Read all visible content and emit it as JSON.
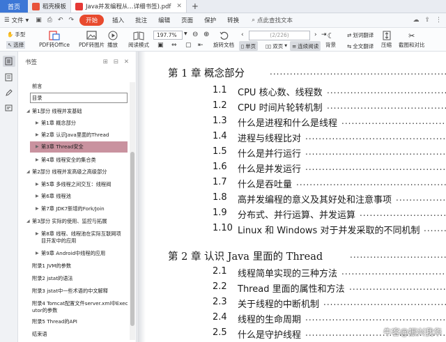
{
  "tabs": [
    {
      "label": "首页"
    },
    {
      "label": "稻壳模板"
    },
    {
      "label": "Java并发编程从...详细书签).pdf"
    }
  ],
  "menu": {
    "file": "文件",
    "items": [
      "开始",
      "插入",
      "批注",
      "编辑",
      "页面",
      "保护",
      "转换"
    ],
    "search": "点此查找文本"
  },
  "toolbar": {
    "hand": "手型",
    "select": "选择",
    "pdf_to_office": "PDF转Office",
    "pdf_to_image": "PDF转图片",
    "play": "播放",
    "read_mode": "阅读模式",
    "zoom": "197.7%",
    "page_input": "(2/226)",
    "rotate": "旋转文档",
    "single": "单页",
    "double": "双页",
    "continuous": "连续阅读",
    "background": "背景",
    "translate_word": "划词翻译",
    "translate_full": "全文翻译",
    "compress": "压缩",
    "screenshot": "截图和对比"
  },
  "bookmarks": {
    "title": "书签",
    "items": [
      {
        "label": "前言",
        "indent": 0,
        "arrow": false,
        "selected": false,
        "boxed": false
      },
      {
        "label": "目录",
        "indent": 0,
        "arrow": false,
        "selected": false,
        "boxed": true
      },
      {
        "label": "第1部分 线程并发基础",
        "indent": 0,
        "arrow": true,
        "selected": false,
        "boxed": false
      },
      {
        "label": "第1章 概念部分",
        "indent": 1,
        "arrow": true,
        "selected": false,
        "boxed": false
      },
      {
        "label": "第2章 认识Java里面的Thread",
        "indent": 1,
        "arrow": true,
        "selected": false,
        "boxed": false
      },
      {
        "label": "第3章 Thread安全",
        "indent": 1,
        "arrow": true,
        "selected": true,
        "boxed": false
      },
      {
        "label": "第4章 线程安全的集合类",
        "indent": 1,
        "arrow": true,
        "selected": false,
        "boxed": false
      },
      {
        "label": "第2部分 线程并发高级之高级部分",
        "indent": 0,
        "arrow": true,
        "selected": false,
        "boxed": false
      },
      {
        "label": "第5章 多线程之间交互：线程阀",
        "indent": 1,
        "arrow": true,
        "selected": false,
        "boxed": false
      },
      {
        "label": "第6章 线程池",
        "indent": 1,
        "arrow": true,
        "selected": false,
        "boxed": false
      },
      {
        "label": "第7章 JDK7新增的Fork/Join",
        "indent": 1,
        "arrow": true,
        "selected": false,
        "boxed": false
      },
      {
        "label": "第3部分 实际的使用、监控与拓展",
        "indent": 0,
        "arrow": true,
        "selected": false,
        "boxed": false
      },
      {
        "label": "第8章 线程、线程池在实际互联网项",
        "label2": "目开发中的应用",
        "indent": 1,
        "arrow": true,
        "selected": false,
        "boxed": false
      },
      {
        "label": "第9章 Android中线程的应用",
        "indent": 1,
        "arrow": true,
        "selected": false,
        "boxed": false
      },
      {
        "label": "附录1 JVM的参数",
        "indent": 0,
        "arrow": false,
        "selected": false,
        "boxed": false
      },
      {
        "label": "附录2 jstat的语法",
        "indent": 0,
        "arrow": false,
        "selected": false,
        "boxed": false
      },
      {
        "label": "附录3 jstat中一些术语的中文解释",
        "indent": 0,
        "arrow": false,
        "selected": false,
        "boxed": false
      },
      {
        "label": "附录4 Tomcat配置文件server.xml中Exec",
        "label2": "utor的参数",
        "indent": 0,
        "arrow": false,
        "selected": false,
        "boxed": false
      },
      {
        "label": "附录5 Thread的API",
        "indent": 0,
        "arrow": false,
        "selected": false,
        "boxed": false
      },
      {
        "label": "结束语",
        "indent": 0,
        "arrow": false,
        "selected": false,
        "boxed": false
      }
    ]
  },
  "toc": {
    "chapter1": "第 1 章   概念部分",
    "chapter1_entries": [
      {
        "num": "1.1",
        "text": "CPU 核心数、线程数"
      },
      {
        "num": "1.2",
        "text": "CPU 时间片轮转机制"
      },
      {
        "num": "1.3",
        "text": "什么是进程和什么是线程"
      },
      {
        "num": "1.4",
        "text": "进程与线程比对"
      },
      {
        "num": "1.5",
        "text": "什么是并行运行"
      },
      {
        "num": "1.6",
        "text": "什么是并发运行"
      },
      {
        "num": "1.7",
        "text": "什么是吞吐量"
      },
      {
        "num": "1.8",
        "text": "高并发编程的意义及其好处和注意事项"
      },
      {
        "num": "1.9",
        "text": "分布式、并行运算、并发运算"
      },
      {
        "num": "1.10",
        "text": "Linux 和 Windows 对于并发采取的不同机制"
      }
    ],
    "chapter2": "第 2 章   认识 Java 里面的 Thread",
    "chapter2_entries": [
      {
        "num": "2.1",
        "text": "线程简单实现的三种方法"
      },
      {
        "num": "2.2",
        "text": "Thread 里面的属性和方法"
      },
      {
        "num": "2.3",
        "text": "关于线程的中断机制"
      },
      {
        "num": "2.4",
        "text": "线程的生命周期"
      },
      {
        "num": "2.5",
        "text": "什么是守护线程"
      }
    ]
  },
  "watermark": "牛客@振兴我华",
  "colors": {
    "accent_blue": "#3c77d6",
    "start_red": "#e84a2e",
    "selected_bookmark": "#c9929f"
  }
}
